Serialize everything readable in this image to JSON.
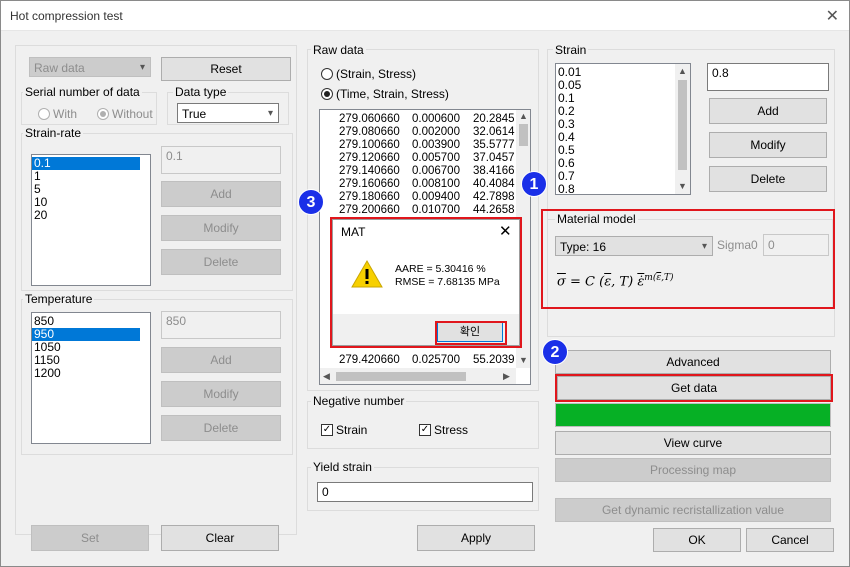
{
  "window": {
    "title": "Hot compression test",
    "close": "✕"
  },
  "top": {
    "data_select": "Raw data",
    "reset_label": "Reset"
  },
  "serial": {
    "label": "Serial number of data",
    "with_label": "With",
    "without_label": "Without"
  },
  "data_type": {
    "label": "Data type",
    "value": "True"
  },
  "strain_rate": {
    "label": "Strain-rate",
    "items": [
      "0.1",
      "1",
      "5",
      "10",
      "20"
    ],
    "input": "0.1",
    "add": "Add",
    "modify": "Modify",
    "delete": "Delete"
  },
  "temperature": {
    "label": "Temperature",
    "items": [
      "850",
      "950",
      "1050",
      "1150",
      "1200"
    ],
    "input": "850",
    "add": "Add",
    "modify": "Modify",
    "delete": "Delete"
  },
  "raw": {
    "label": "Raw data",
    "opt1": "(Strain, Stress)",
    "opt2": "(Time, Strain, Stress)",
    "rows": [
      [
        "279.060660",
        "0.000600",
        "20.2845"
      ],
      [
        "279.080660",
        "0.002000",
        "32.0614"
      ],
      [
        "279.100660",
        "0.003900",
        "35.5777"
      ],
      [
        "279.120660",
        "0.005700",
        "37.0457"
      ],
      [
        "279.140660",
        "0.006700",
        "38.4166"
      ],
      [
        "279.160660",
        "0.008100",
        "40.4084"
      ],
      [
        "279.180660",
        "0.009400",
        "42.7898"
      ],
      [
        "279.200660",
        "0.010700",
        "44.2658"
      ]
    ],
    "last_row": [
      "279.420660",
      "0.025700",
      "55.2039"
    ]
  },
  "negative": {
    "label": "Negative number",
    "strain": "Strain",
    "stress": "Stress"
  },
  "yield": {
    "label": "Yield strain",
    "value": "0"
  },
  "strain": {
    "label": "Strain",
    "items": [
      "0.01",
      "0.05",
      "0.1",
      "0.2",
      "0.3",
      "0.4",
      "0.5",
      "0.6",
      "0.7",
      "0.8"
    ],
    "input": "0.8",
    "add": "Add",
    "modify": "Modify",
    "delete": "Delete"
  },
  "material": {
    "label": "Material model",
    "type": "Type: 16",
    "sigma_label": "Sigma0",
    "sigma_value": "0"
  },
  "buttons": {
    "advanced": "Advanced",
    "get_data": "Get data",
    "view_curve": "View curve",
    "processing_map": "Processing map",
    "dynamic": "Get dynamic recristallization value",
    "set": "Set",
    "clear": "Clear",
    "apply": "Apply",
    "ok": "OK",
    "cancel": "Cancel"
  },
  "dialog": {
    "title": "MAT",
    "aare": "AARE = 5.30416 %",
    "rmse": "RMSE = 7.68135 MPa",
    "ok": "확인"
  },
  "badges": [
    "1",
    "2",
    "3"
  ],
  "colors": {
    "highlight": "#e0161c",
    "progress": "#06b025",
    "badge": "#1a2fe8",
    "selection": "#0078d7"
  },
  "progress": {
    "fraction": 1.0
  }
}
